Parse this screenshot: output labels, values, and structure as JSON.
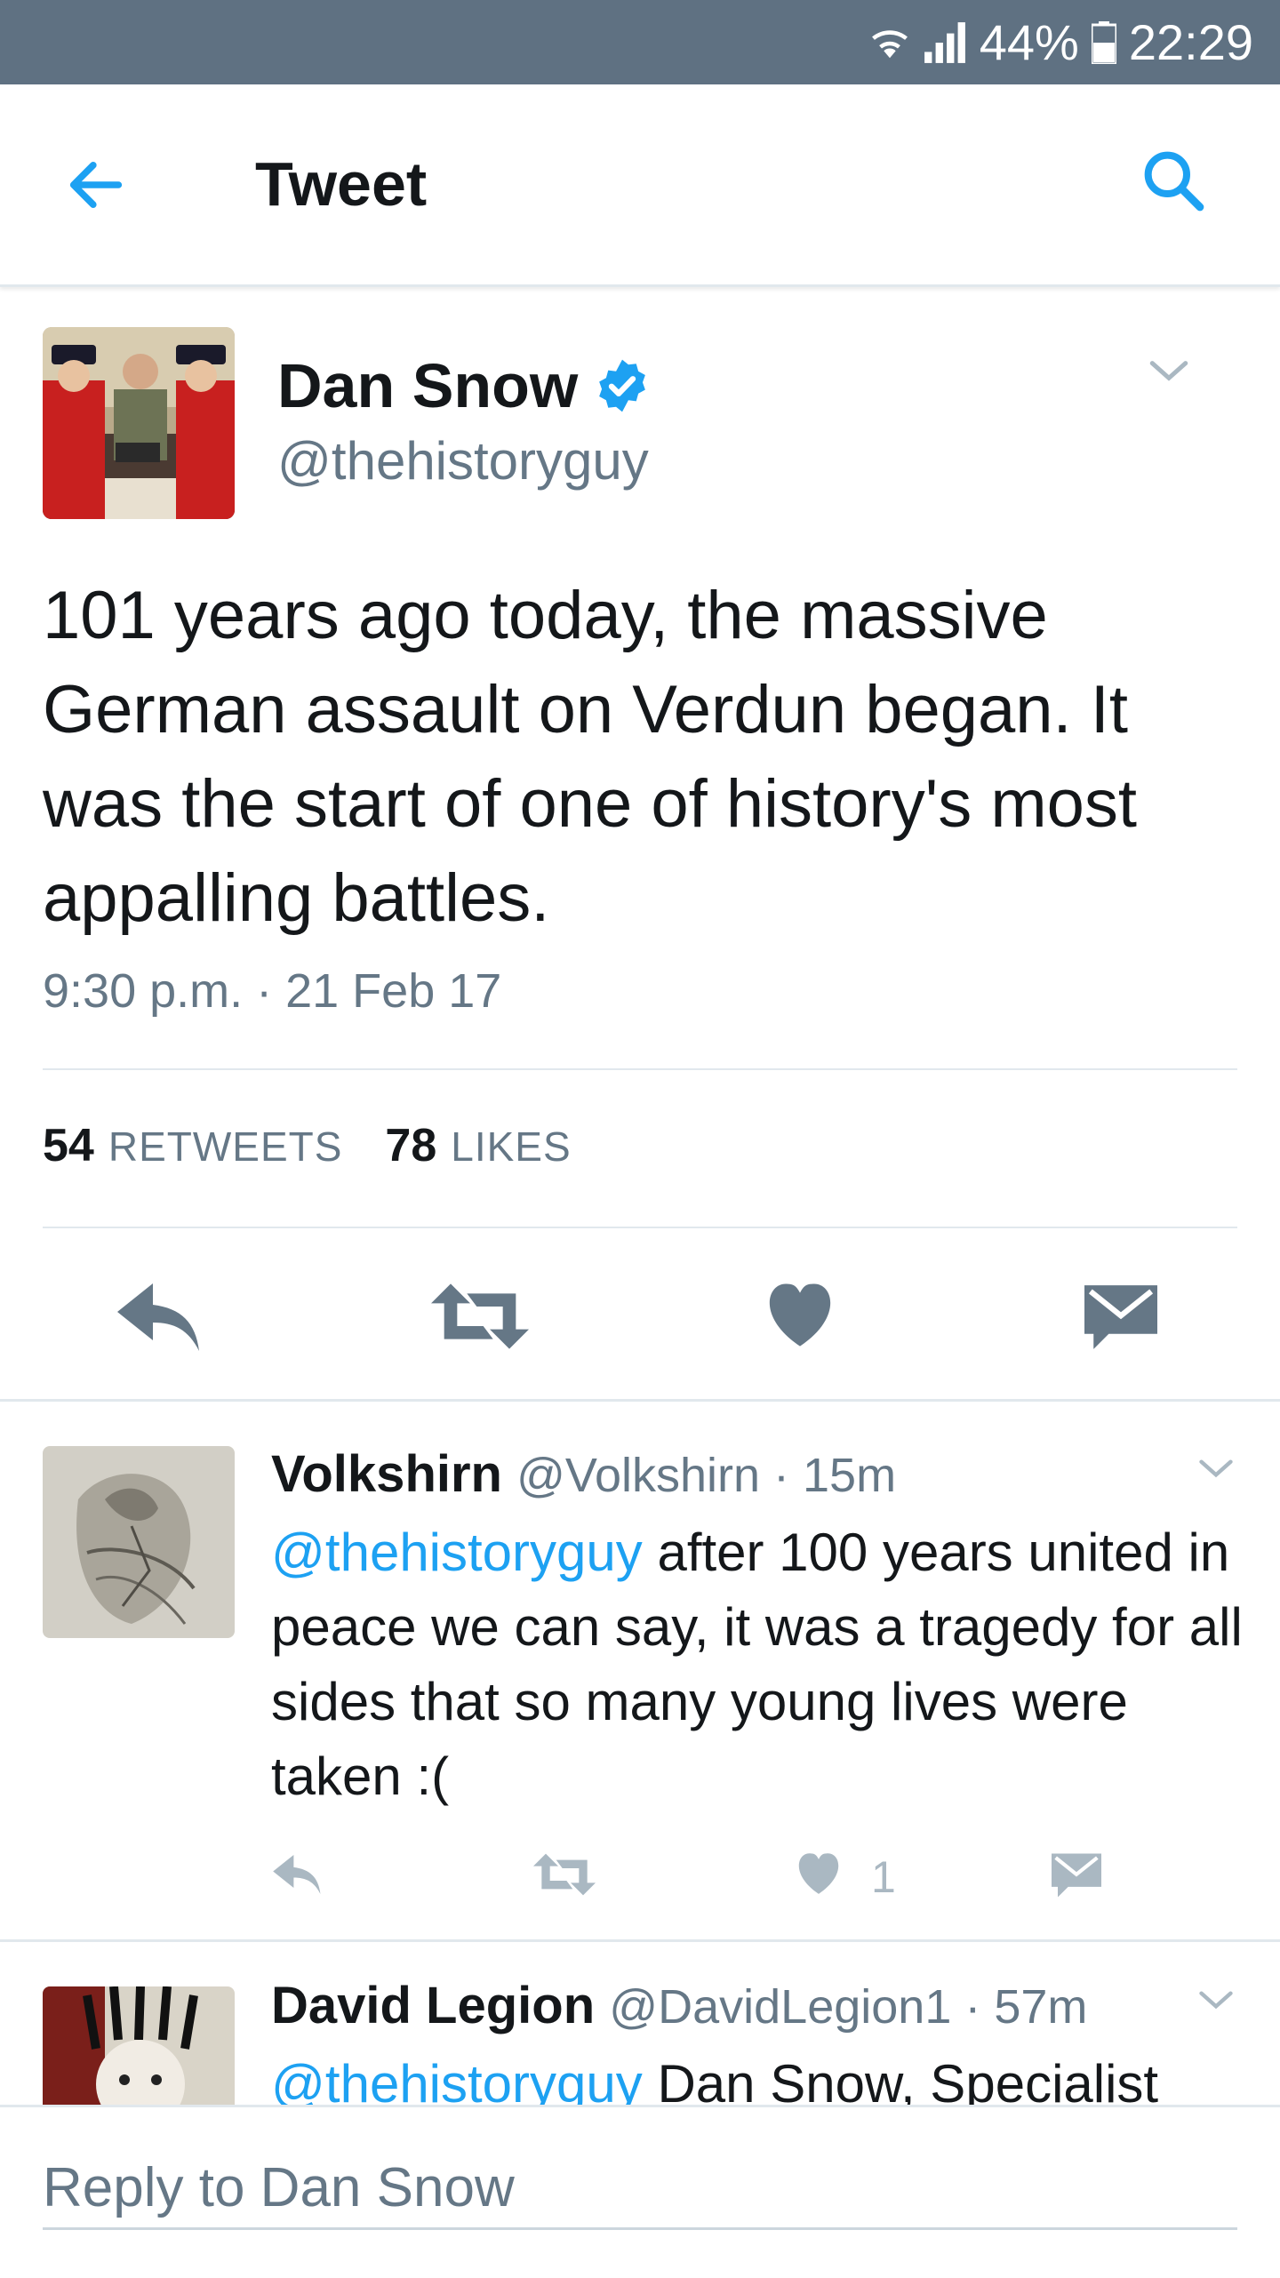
{
  "status_bar": {
    "battery": "44%",
    "time": "22:29"
  },
  "header": {
    "title": "Tweet"
  },
  "tweet": {
    "author_name": "Dan Snow",
    "author_handle": "@thehistoryguy",
    "text": "101 years ago today, the massive German assault on Verdun began. It was the start of one of history's most appalling battles.",
    "timestamp": "9:30 p.m. · 21 Feb 17",
    "retweets_count": "54",
    "retweets_label": "RETWEETS",
    "likes_count": "78",
    "likes_label": "LIKES"
  },
  "replies": [
    {
      "name": "Volkshirn",
      "handle": "@Volkshirn · 15m",
      "mention": "@thehistoryguy",
      "text": " after 100 years united in peace we can say, it was a tragedy for all sides that so many young lives were taken :(",
      "like_count": "1"
    },
    {
      "name": "David Legion",
      "handle": "@DavidLegion1 · 57m",
      "mention": "@thehistoryguy",
      "text": " Dan Snow, Specialist"
    }
  ],
  "composer": {
    "placeholder": "Reply to Dan Snow"
  },
  "colors": {
    "accent": "#1da1f2",
    "status_bar": "#5f7182",
    "secondary_text": "#657786",
    "icon_gray": "#657786"
  }
}
